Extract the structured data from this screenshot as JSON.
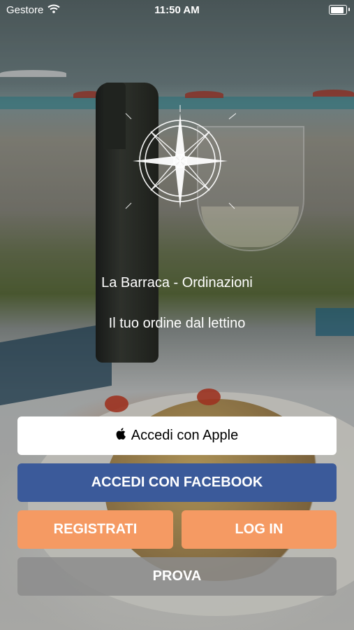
{
  "status_bar": {
    "carrier": "Gestore",
    "time": "11:50 AM",
    "battery_level": 1.0
  },
  "header": {
    "title": "La Barraca - Ordinazioni",
    "subtitle": "Il tuo ordine dal lettino"
  },
  "buttons": {
    "apple_label": "Accedi con Apple",
    "facebook_label": "ACCEDI CON FACEBOOK",
    "register_label": "REGISTRATI",
    "login_label": "LOG IN",
    "try_label": "PROVA"
  },
  "icons": {
    "logo": "compass-rose-icon",
    "apple": "apple-icon",
    "wifi": "wifi-icon",
    "battery": "battery-icon"
  },
  "colors": {
    "facebook": "#3b5a9a",
    "accent": "#f59a63",
    "try": "#8c8c8c"
  }
}
